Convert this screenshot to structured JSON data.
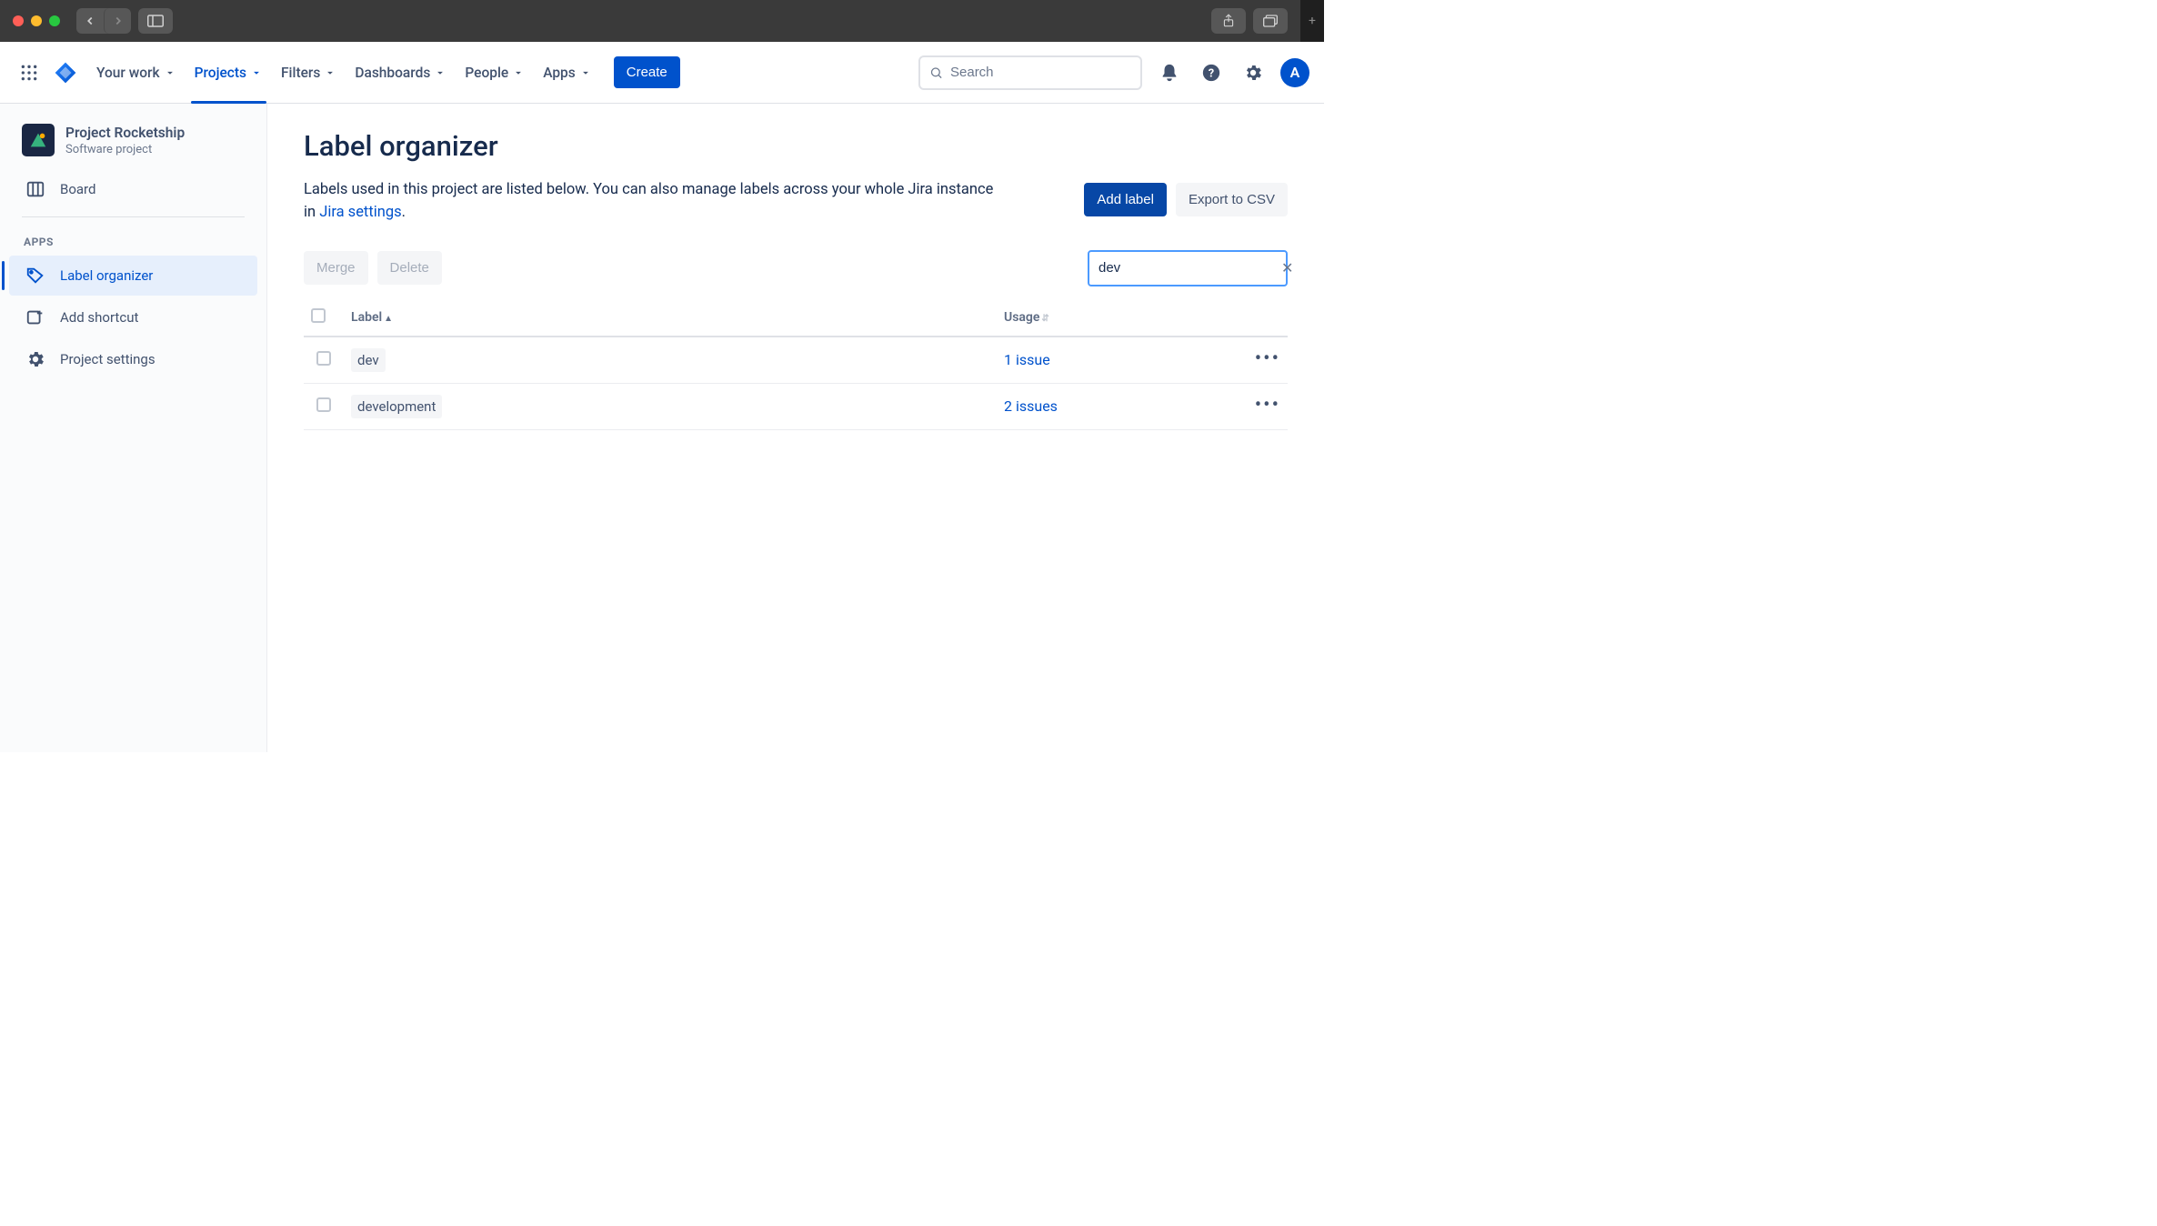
{
  "topnav": {
    "items": [
      {
        "label": "Your work"
      },
      {
        "label": "Projects"
      },
      {
        "label": "Filters"
      },
      {
        "label": "Dashboards"
      },
      {
        "label": "People"
      },
      {
        "label": "Apps"
      }
    ],
    "create_label": "Create",
    "search_placeholder": "Search",
    "avatar_initial": "A"
  },
  "sidebar": {
    "project_name": "Project Rocketship",
    "project_type": "Software project",
    "board_label": "Board",
    "apps_heading": "APPS",
    "label_organizer_label": "Label organizer",
    "add_shortcut_label": "Add shortcut",
    "project_settings_label": "Project settings"
  },
  "main": {
    "title": "Label organizer",
    "description_prefix": "Labels used in this project are listed below. You can also manage labels across your whole Jira instance in ",
    "description_link": "Jira settings",
    "description_suffix": ".",
    "add_label_btn": "Add label",
    "export_btn": "Export to CSV",
    "merge_btn": "Merge",
    "delete_btn": "Delete",
    "filter_value": "dev",
    "columns": {
      "label": "Label",
      "usage": "Usage"
    },
    "rows": [
      {
        "label": "dev",
        "usage": "1 issue"
      },
      {
        "label": "development",
        "usage": "2 issues"
      }
    ]
  }
}
